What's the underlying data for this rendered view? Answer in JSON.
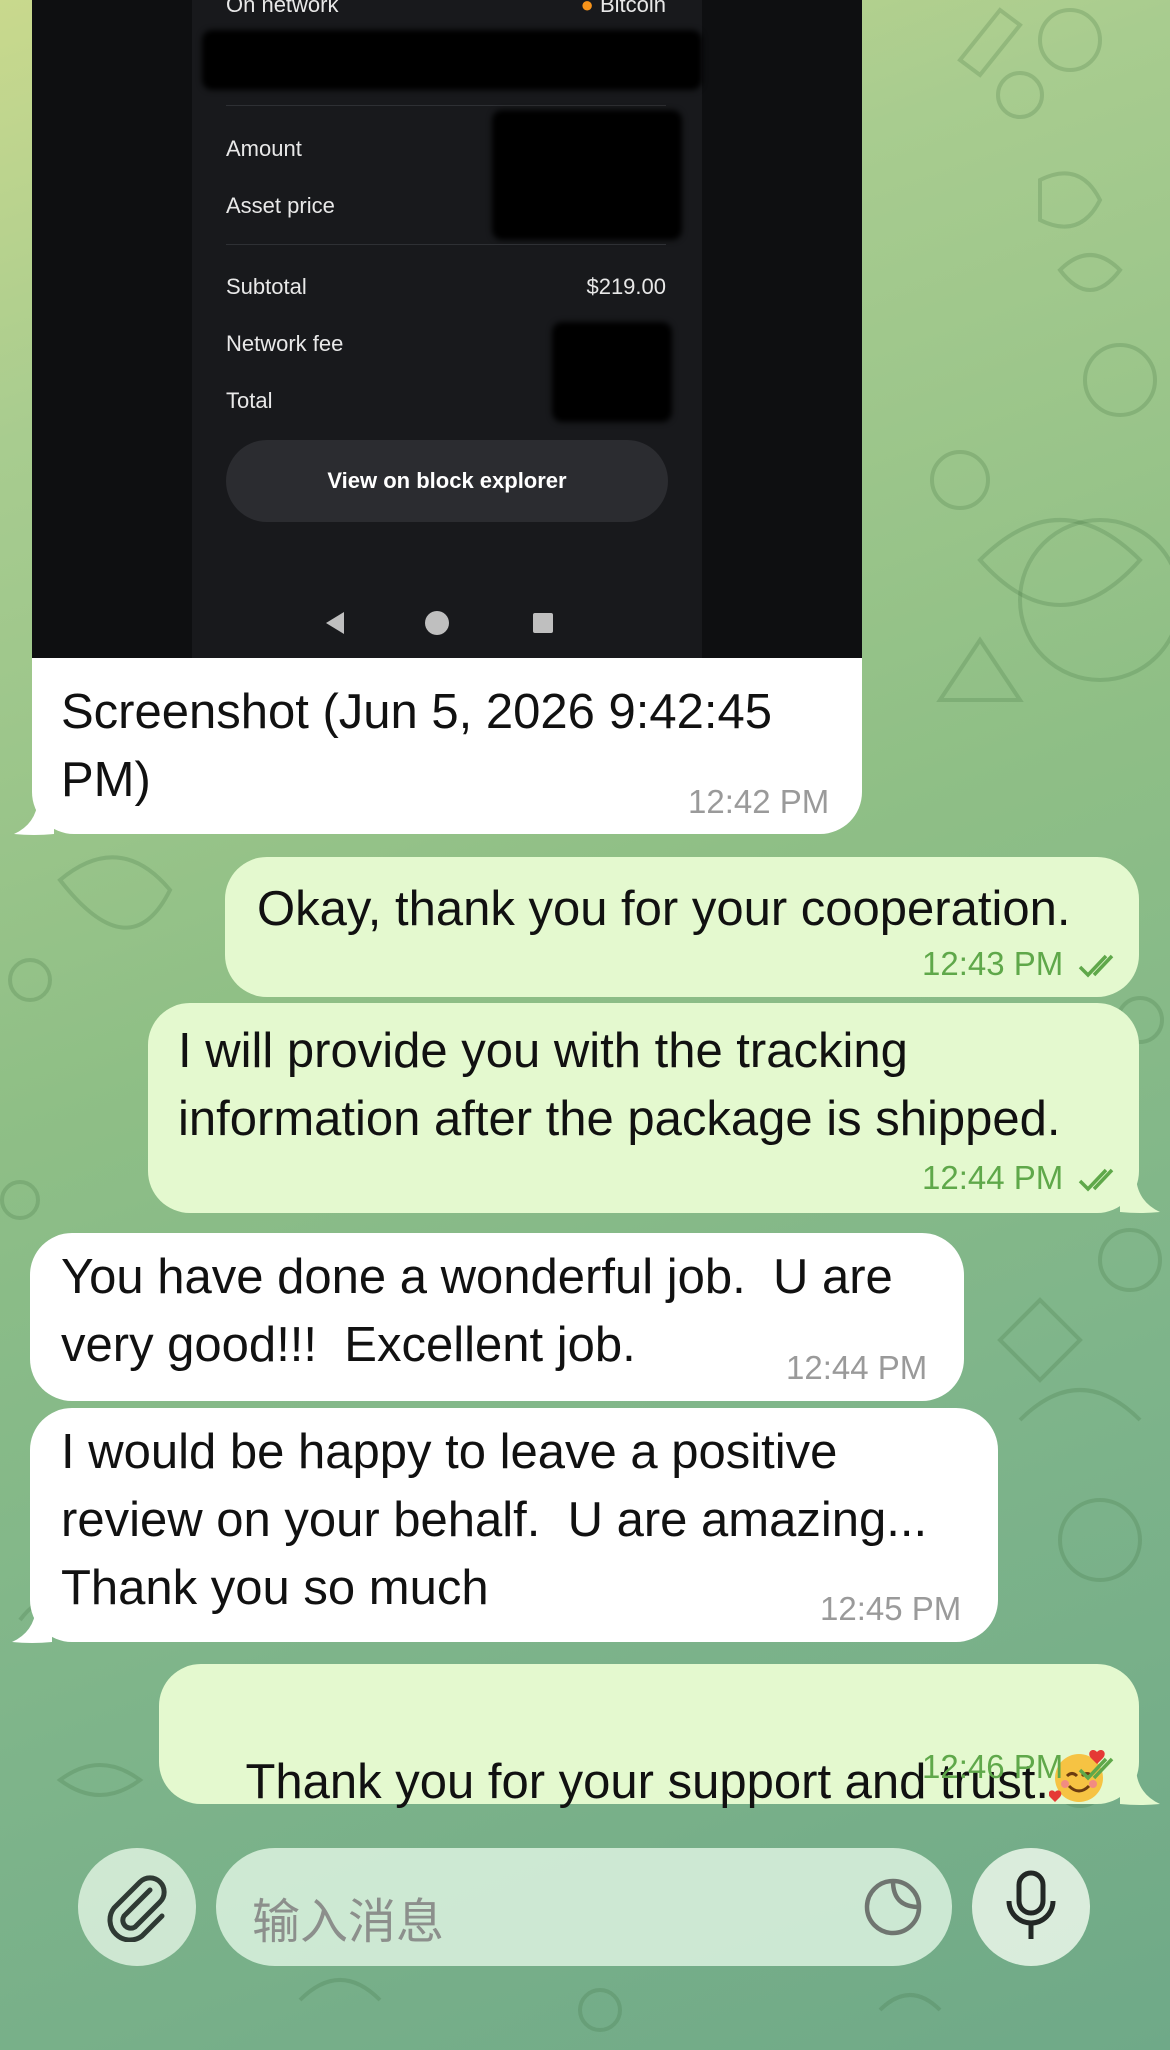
{
  "screenshot_image": {
    "rows": [
      {
        "label": "On network",
        "value": "Bitcoin"
      },
      {
        "label": "Amount",
        "value": ""
      },
      {
        "label": "Asset price",
        "value": ""
      },
      {
        "label": "Subtotal",
        "value": "$219.00"
      },
      {
        "label": "Network fee",
        "value": ""
      },
      {
        "label": "Total",
        "value": ""
      }
    ],
    "explorer_button": "View on block explorer"
  },
  "messages": [
    {
      "direction": "in",
      "text": "Screenshot (Jun 5, 2026 9:42:45\nPM)",
      "time": "12:42 PM"
    },
    {
      "direction": "out",
      "text": "Okay, thank you for your cooperation.",
      "time": "12:43 PM",
      "read": true
    },
    {
      "direction": "out",
      "text": "I will provide you with the tracking\ninformation after the package is shipped.",
      "time": "12:44 PM",
      "read": true
    },
    {
      "direction": "in",
      "text": "You have done a wonderful job.  U are\nvery good!!!  Excellent job.",
      "time": "12:44 PM"
    },
    {
      "direction": "in",
      "text": "I would be happy to leave a positive\nreview on your behalf.  U are amazing...\nThank you so much",
      "time": "12:45 PM"
    },
    {
      "direction": "out",
      "text": "Thank you for your support and trust.",
      "emoji": "smiling-face-with-hearts",
      "time": "12:46 PM",
      "read": true
    }
  ],
  "composer": {
    "placeholder": "输入消息",
    "icons": [
      "paperclip-icon",
      "sticker-icon",
      "microphone-icon"
    ]
  },
  "colors": {
    "incoming_bubble": "#ffffff",
    "outgoing_bubble": "#e4f9cf",
    "outgoing_time": "#5fa84a",
    "incoming_time": "#9a9a9a"
  }
}
